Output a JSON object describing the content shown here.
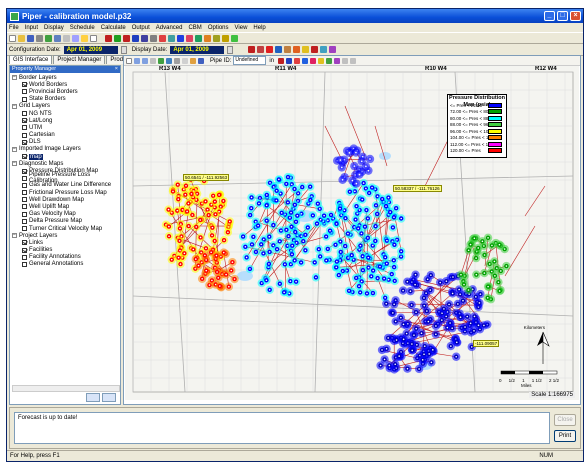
{
  "window": {
    "title": "Piper - calibration model.p32"
  },
  "menu": [
    "File",
    "Input",
    "Display",
    "Schedule",
    "Calculate",
    "Output",
    "Advanced",
    "CBM",
    "Options",
    "View",
    "Help"
  ],
  "datebar": {
    "config_label": "Configuration Date:",
    "config_date": "Apr 01, 2009",
    "display_label": "Display Date:",
    "display_date": "Apr 01, 2009"
  },
  "tabs": [
    "GIS Interface",
    "Project Manager",
    "Production Plotting"
  ],
  "property_manager": {
    "title": "Property Manager",
    "groups": [
      {
        "label": "Border Layers",
        "items": [
          {
            "label": "World Borders",
            "checked": true
          },
          {
            "label": "Provincial Borders",
            "checked": false
          },
          {
            "label": "State Borders",
            "checked": false
          }
        ]
      },
      {
        "label": "Grid Layers",
        "items": [
          {
            "label": "NG NTS",
            "checked": false
          },
          {
            "label": "Lat/Long",
            "checked": true
          },
          {
            "label": "UTM",
            "checked": false
          },
          {
            "label": "Cartesian",
            "checked": false
          },
          {
            "label": "DLS",
            "checked": true
          }
        ]
      },
      {
        "label": "Imported Image Layers",
        "items": [
          {
            "label": "map",
            "checked": true,
            "selected": true
          }
        ]
      },
      {
        "label": "Diagnostic Maps",
        "items": [
          {
            "label": "Pressure Distribution Map",
            "checked": true
          },
          {
            "label": "Pipeline Pressure Loss Calibration",
            "checked": false
          },
          {
            "label": "Gas and Water Line Difference",
            "checked": false
          },
          {
            "label": "Frictional Pressure Loss Map",
            "checked": false
          },
          {
            "label": "Well Drawdown Map",
            "checked": false
          },
          {
            "label": "Well Uplift Map",
            "checked": false
          },
          {
            "label": "Gas Velocity Map",
            "checked": false
          },
          {
            "label": "Delta Pressure Map",
            "checked": false
          },
          {
            "label": "Turner Critical Velocity Map",
            "checked": false
          }
        ]
      },
      {
        "label": "Project Layers",
        "items": [
          {
            "label": "Links",
            "checked": true
          },
          {
            "label": "Facilities",
            "checked": true
          },
          {
            "label": "Facility Annotations",
            "checked": false
          },
          {
            "label": "General Annotations",
            "checked": false
          }
        ]
      }
    ]
  },
  "maptools": {
    "pipe_id_label": "Pipe ID:",
    "pipe_id_value": "Undefined",
    "unit": "in"
  },
  "map": {
    "ranges": [
      "R13 W4",
      "R11 W4",
      "R10 W4",
      "R12 W4"
    ],
    "legend_title": "Pressure Distribution Map (psia)",
    "legend": [
      {
        "label": "<= Pres <  72.00",
        "color": "#0000ff"
      },
      {
        "label": "72.00 <= Pres <  80.00",
        "color": "#00a000"
      },
      {
        "label": "80.00 <= Pres <  88.00",
        "color": "#00ffff"
      },
      {
        "label": "88.00 <= Pres <  96.00",
        "color": "#40d040"
      },
      {
        "label": "96.00 <= Pres < 104.00",
        "color": "#ffff00"
      },
      {
        "label": "104.00 <= Pres < 112.00",
        "color": "#ff8000"
      },
      {
        "label": "112.00 <= Pres < 120.00",
        "color": "#ff00ff"
      },
      {
        "label": "120.00 <= Pres",
        "color": "#ff0000"
      }
    ],
    "tags": [
      "50.6541 / -111.92563",
      "50.58337 / -111.76126",
      "-111.09057"
    ],
    "scale_label": "Scale 1:166975",
    "scale_ticks": [
      "0",
      "1/2",
      "1",
      "1 1/2",
      "2 1/2"
    ],
    "scale_unit": "Miles",
    "north_label": "Kilometers"
  },
  "messages": {
    "text": "Forecast is up to date!",
    "print_label": "Print",
    "close_label": "Close"
  },
  "status": {
    "help": "For Help, press F1",
    "num": "NUM"
  }
}
